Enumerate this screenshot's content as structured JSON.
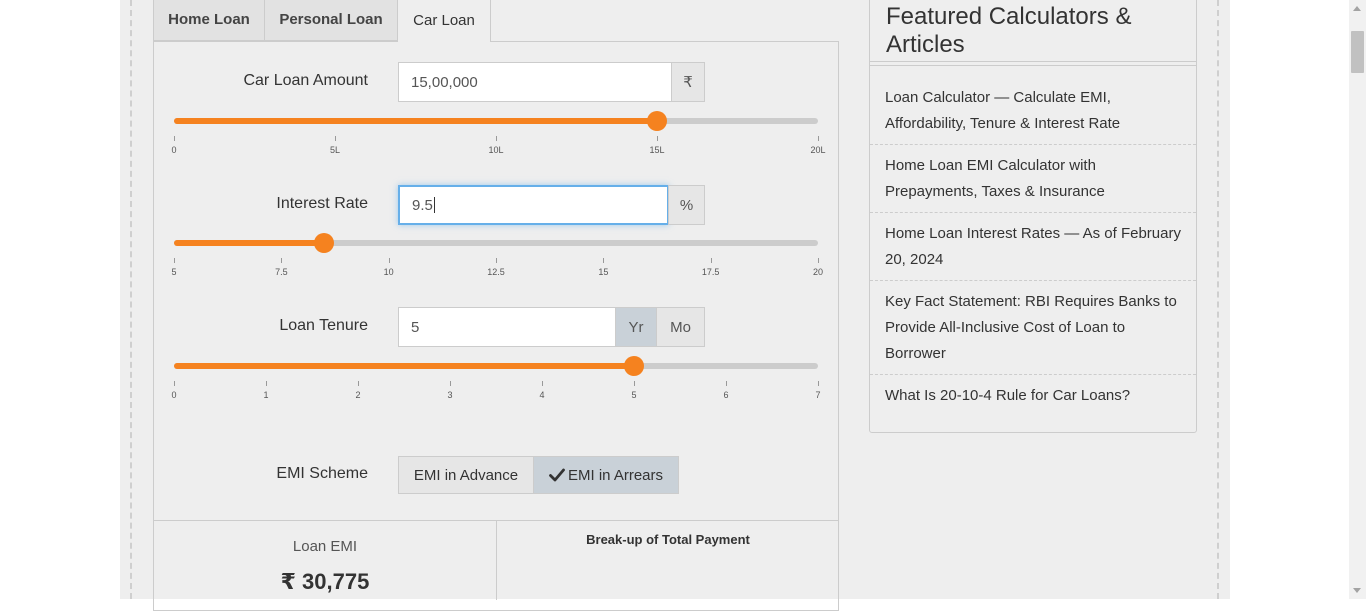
{
  "tabs": [
    {
      "label": "Home Loan",
      "active": false
    },
    {
      "label": "Personal Loan",
      "active": false
    },
    {
      "label": "Car Loan",
      "active": true
    }
  ],
  "amount": {
    "label": "Car Loan Amount",
    "value": "15,00,000",
    "unit": "₹",
    "slider_value": 1500000,
    "slider_min": 0,
    "slider_max": 2000000,
    "ticks": [
      "0",
      "5L",
      "10L",
      "15L",
      "20L"
    ]
  },
  "interest": {
    "label": "Interest Rate",
    "value": "9.5",
    "unit": "%",
    "slider_value": 8.5,
    "slider_min": 5,
    "slider_max": 20,
    "ticks": [
      "5",
      "7.5",
      "10",
      "12.5",
      "15",
      "17.5",
      "20"
    ]
  },
  "tenure": {
    "label": "Loan Tenure",
    "value": "5",
    "unit_year": "Yr",
    "unit_month": "Mo",
    "selected_unit": "Yr",
    "slider_value": 5,
    "slider_min": 0,
    "slider_max": 7,
    "ticks": [
      "0",
      "1",
      "2",
      "3",
      "4",
      "5",
      "6",
      "7"
    ]
  },
  "emi_scheme": {
    "label": "EMI Scheme",
    "option_advance": "EMI in Advance",
    "option_arrears": "EMI in Arrears",
    "selected": "EMI in Arrears"
  },
  "results": {
    "loan_emi_label": "Loan EMI",
    "loan_emi_value": "₹ 30,775",
    "breakup_title": "Break-up of Total Payment"
  },
  "sidebar": {
    "title": "Featured Calculators & Articles",
    "items": [
      {
        "label": "Loan Calculator — Calculate EMI, Affordability, Tenure & Interest Rate"
      },
      {
        "label": "Home Loan EMI Calculator with Prepayments, Taxes & Insurance"
      },
      {
        "label": "Home Loan Interest Rates — As of February 20, 2024"
      },
      {
        "label": "Key Fact Statement: RBI Requires Banks to Provide All-Inclusive Cost of Loan to Borrower"
      },
      {
        "label": "What Is 20-10-4 Rule for Car Loans?"
      }
    ]
  },
  "colors": {
    "slider_fill": "#f5821f",
    "slider_track": "#cccccc",
    "focus_border": "#66afe9",
    "active_addon": "#c9d1d8"
  },
  "icons": {
    "check": "check-icon",
    "scroll_up": "scroll-up-icon",
    "scroll_down": "scroll-down-icon"
  }
}
